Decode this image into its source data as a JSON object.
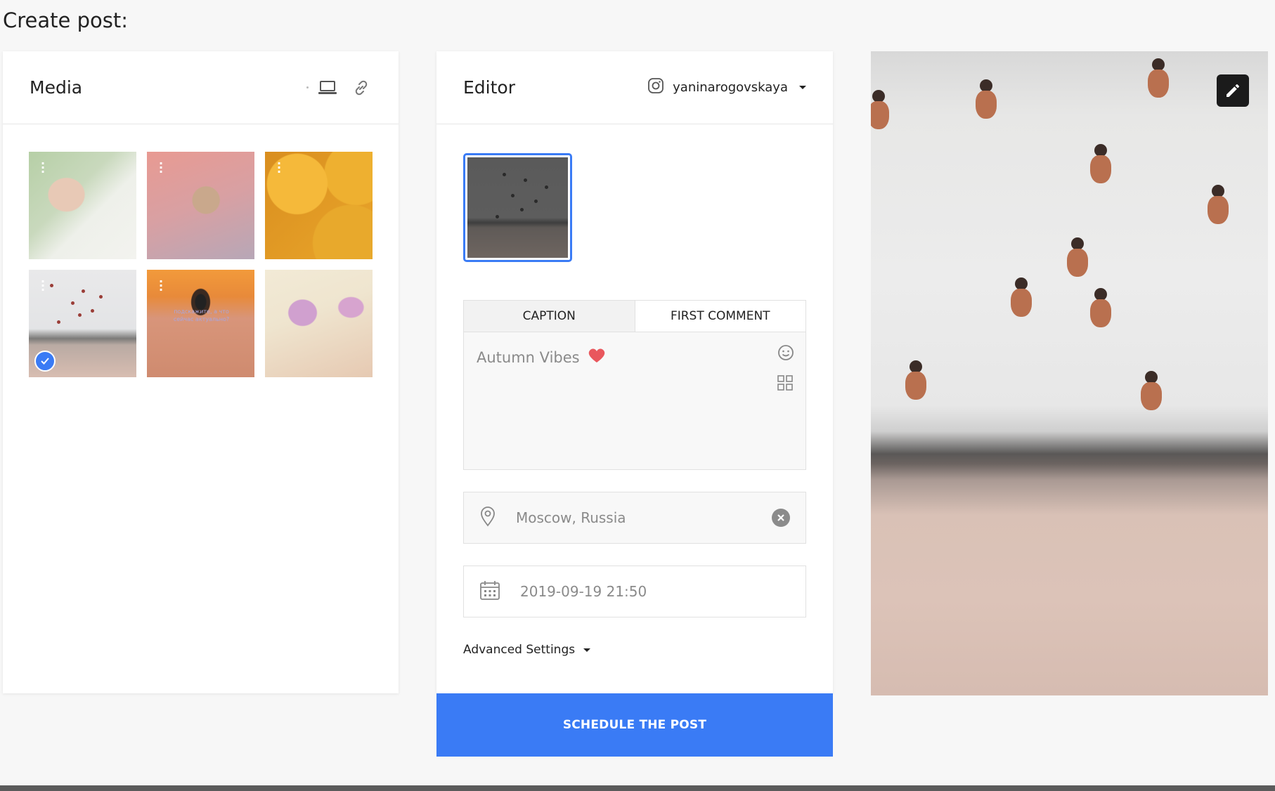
{
  "page": {
    "title": "Create post:"
  },
  "media": {
    "title": "Media",
    "icons": [
      "dot-icon",
      "laptop-icon",
      "link-icon"
    ],
    "thumbnails": [
      {
        "name": "green-hair-portrait",
        "selected": false
      },
      {
        "name": "leaning-man-pink",
        "selected": false
      },
      {
        "name": "yellow-balloons",
        "selected": false
      },
      {
        "name": "beach-swimmers",
        "selected": true
      },
      {
        "name": "orange-face-freckles",
        "selected": false,
        "caption": "подскажите, а что сейчас актуально?"
      },
      {
        "name": "pink-sunglasses",
        "selected": false
      }
    ]
  },
  "editor": {
    "title": "Editor",
    "account": "yaninarogovskaya",
    "tabs": {
      "caption": "CAPTION",
      "first_comment": "FIRST COMMENT"
    },
    "caption_text": "Autumn Vibes",
    "location": "Moscow, Russia",
    "datetime": "2019-09-19 21:50",
    "advanced_settings": "Advanced Settings",
    "schedule_button": "SCHEDULE THE POST"
  },
  "colors": {
    "accent": "#3a7bf5",
    "heart": "#e9575d",
    "page_bg": "#f7f7f7"
  }
}
